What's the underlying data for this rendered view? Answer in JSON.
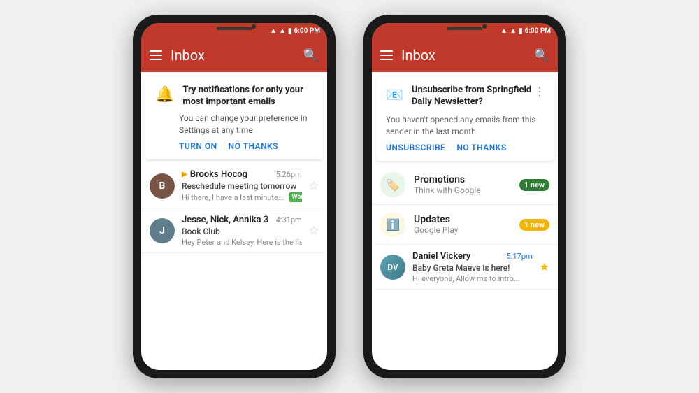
{
  "phone1": {
    "status": {
      "time": "6:00 PM"
    },
    "appbar": {
      "title": "Inbox"
    },
    "notification": {
      "icon": "🔔",
      "title": "Try notifications for only your most important emails",
      "body": "You can change your preference in Settings at any time",
      "action1": "TURN ON",
      "action2": "NO THANKS"
    },
    "emails": [
      {
        "sender": "Brooks Hocog",
        "subject": "Reschedule meeting tomorrow",
        "preview": "Hi there, I have a last minute...",
        "time": "5:26pm",
        "tag": "Work",
        "avatar_initial": "B",
        "has_forward": true
      },
      {
        "sender": "Jesse, Nick, Annika 3",
        "subject": "Book Club",
        "preview": "Hey Peter and Kelsey, Here is the list...",
        "time": "4:31pm",
        "tag": "",
        "avatar_initial": "J",
        "has_forward": false
      }
    ]
  },
  "phone2": {
    "status": {
      "time": "6:00 PM"
    },
    "appbar": {
      "title": "Inbox"
    },
    "unsubscribe": {
      "title": "Unsubscribe from Springfield Daily Newsletter?",
      "body": "You haven't opened any emails from this sender in the last month",
      "action1": "UNSUBSCRIBE",
      "action2": "NO THANKS"
    },
    "categories": [
      {
        "name": "Promotions",
        "sub": "Think with Google",
        "badge": "1 new",
        "badge_color": "green",
        "icon": "🏷️",
        "icon_color": "#2e7d32"
      },
      {
        "name": "Updates",
        "sub": "Google Play",
        "badge": "1 new",
        "badge_color": "yellow",
        "icon": "ℹ️",
        "icon_color": "#f4b400"
      }
    ],
    "email": {
      "sender": "Daniel Vickery",
      "subject": "Baby Greta Maeve is here!",
      "preview": "Hi everyone, Allow me to intro...",
      "time": "5:17pm",
      "starred": true
    }
  }
}
